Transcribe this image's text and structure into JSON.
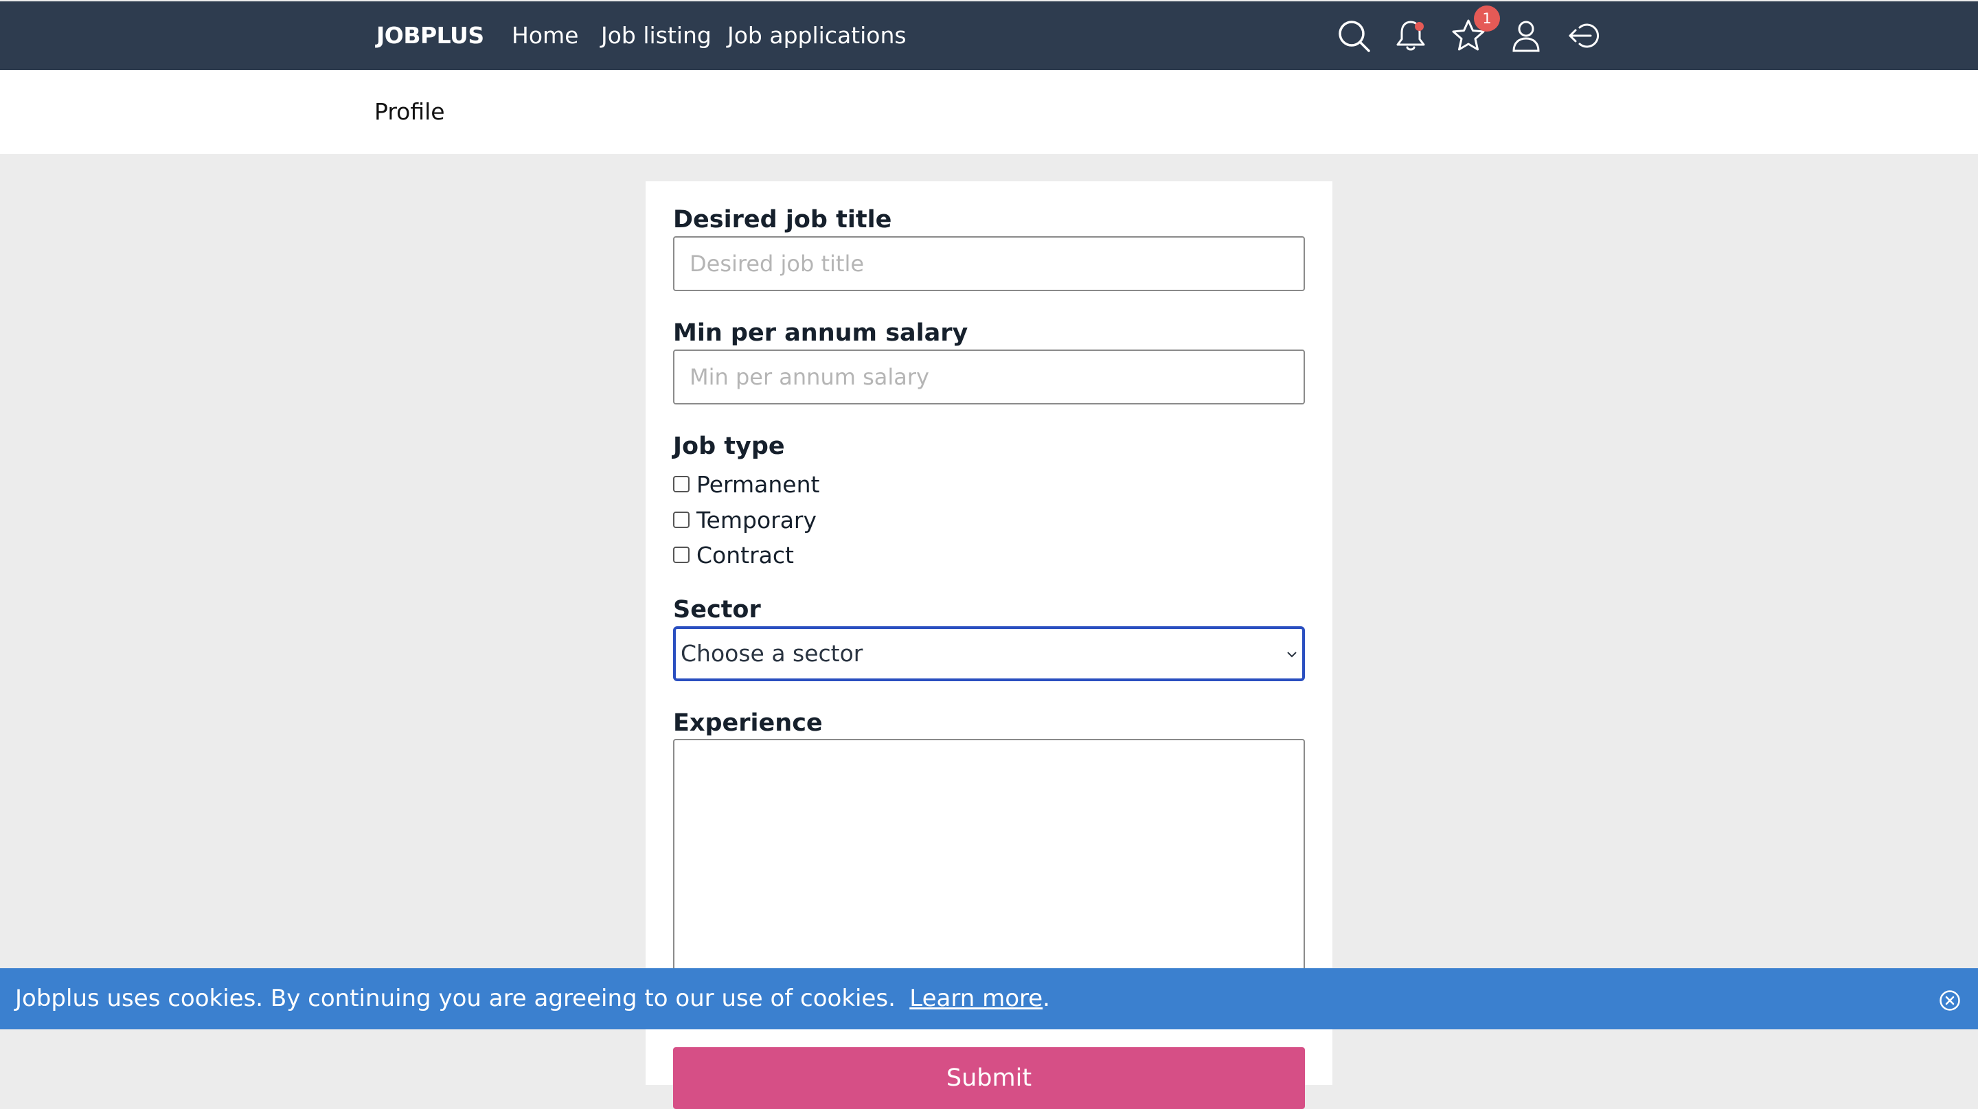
{
  "navbar": {
    "brand": "JOBPLUS",
    "links": [
      {
        "label": "Home"
      },
      {
        "label": "Job listing"
      },
      {
        "label": "Job applications"
      }
    ],
    "icons": [
      "search-icon",
      "bell-icon",
      "star-icon",
      "user-icon",
      "logout-icon"
    ],
    "favorites_badge": "1",
    "bar_color": "#2e3c4f",
    "badge_color": "#e55a56"
  },
  "subheader": {
    "title": "Profile"
  },
  "form": {
    "desired_job_title": {
      "label": "Desired job title",
      "placeholder": "Desired job title",
      "value": ""
    },
    "min_salary": {
      "label": "Min per annum salary",
      "placeholder": "Min per annum salary",
      "value": ""
    },
    "job_type": {
      "label": "Job type",
      "options": [
        {
          "label": "Permanent",
          "checked": false
        },
        {
          "label": "Temporary",
          "checked": false
        },
        {
          "label": "Contract",
          "checked": false
        }
      ]
    },
    "sector": {
      "label": "Sector",
      "selected": "Choose a sector",
      "focus_color": "#2a4fc0"
    },
    "experience": {
      "label": "Experience",
      "value": ""
    },
    "submit_label": "Submit",
    "submit_color": "#d64f86"
  },
  "cookie_banner": {
    "text": "Jobplus uses cookies. By continuing you are agreeing to our use of cookies.",
    "link_text": "Learn more",
    "trailing": ".",
    "background": "#3b80cf"
  }
}
